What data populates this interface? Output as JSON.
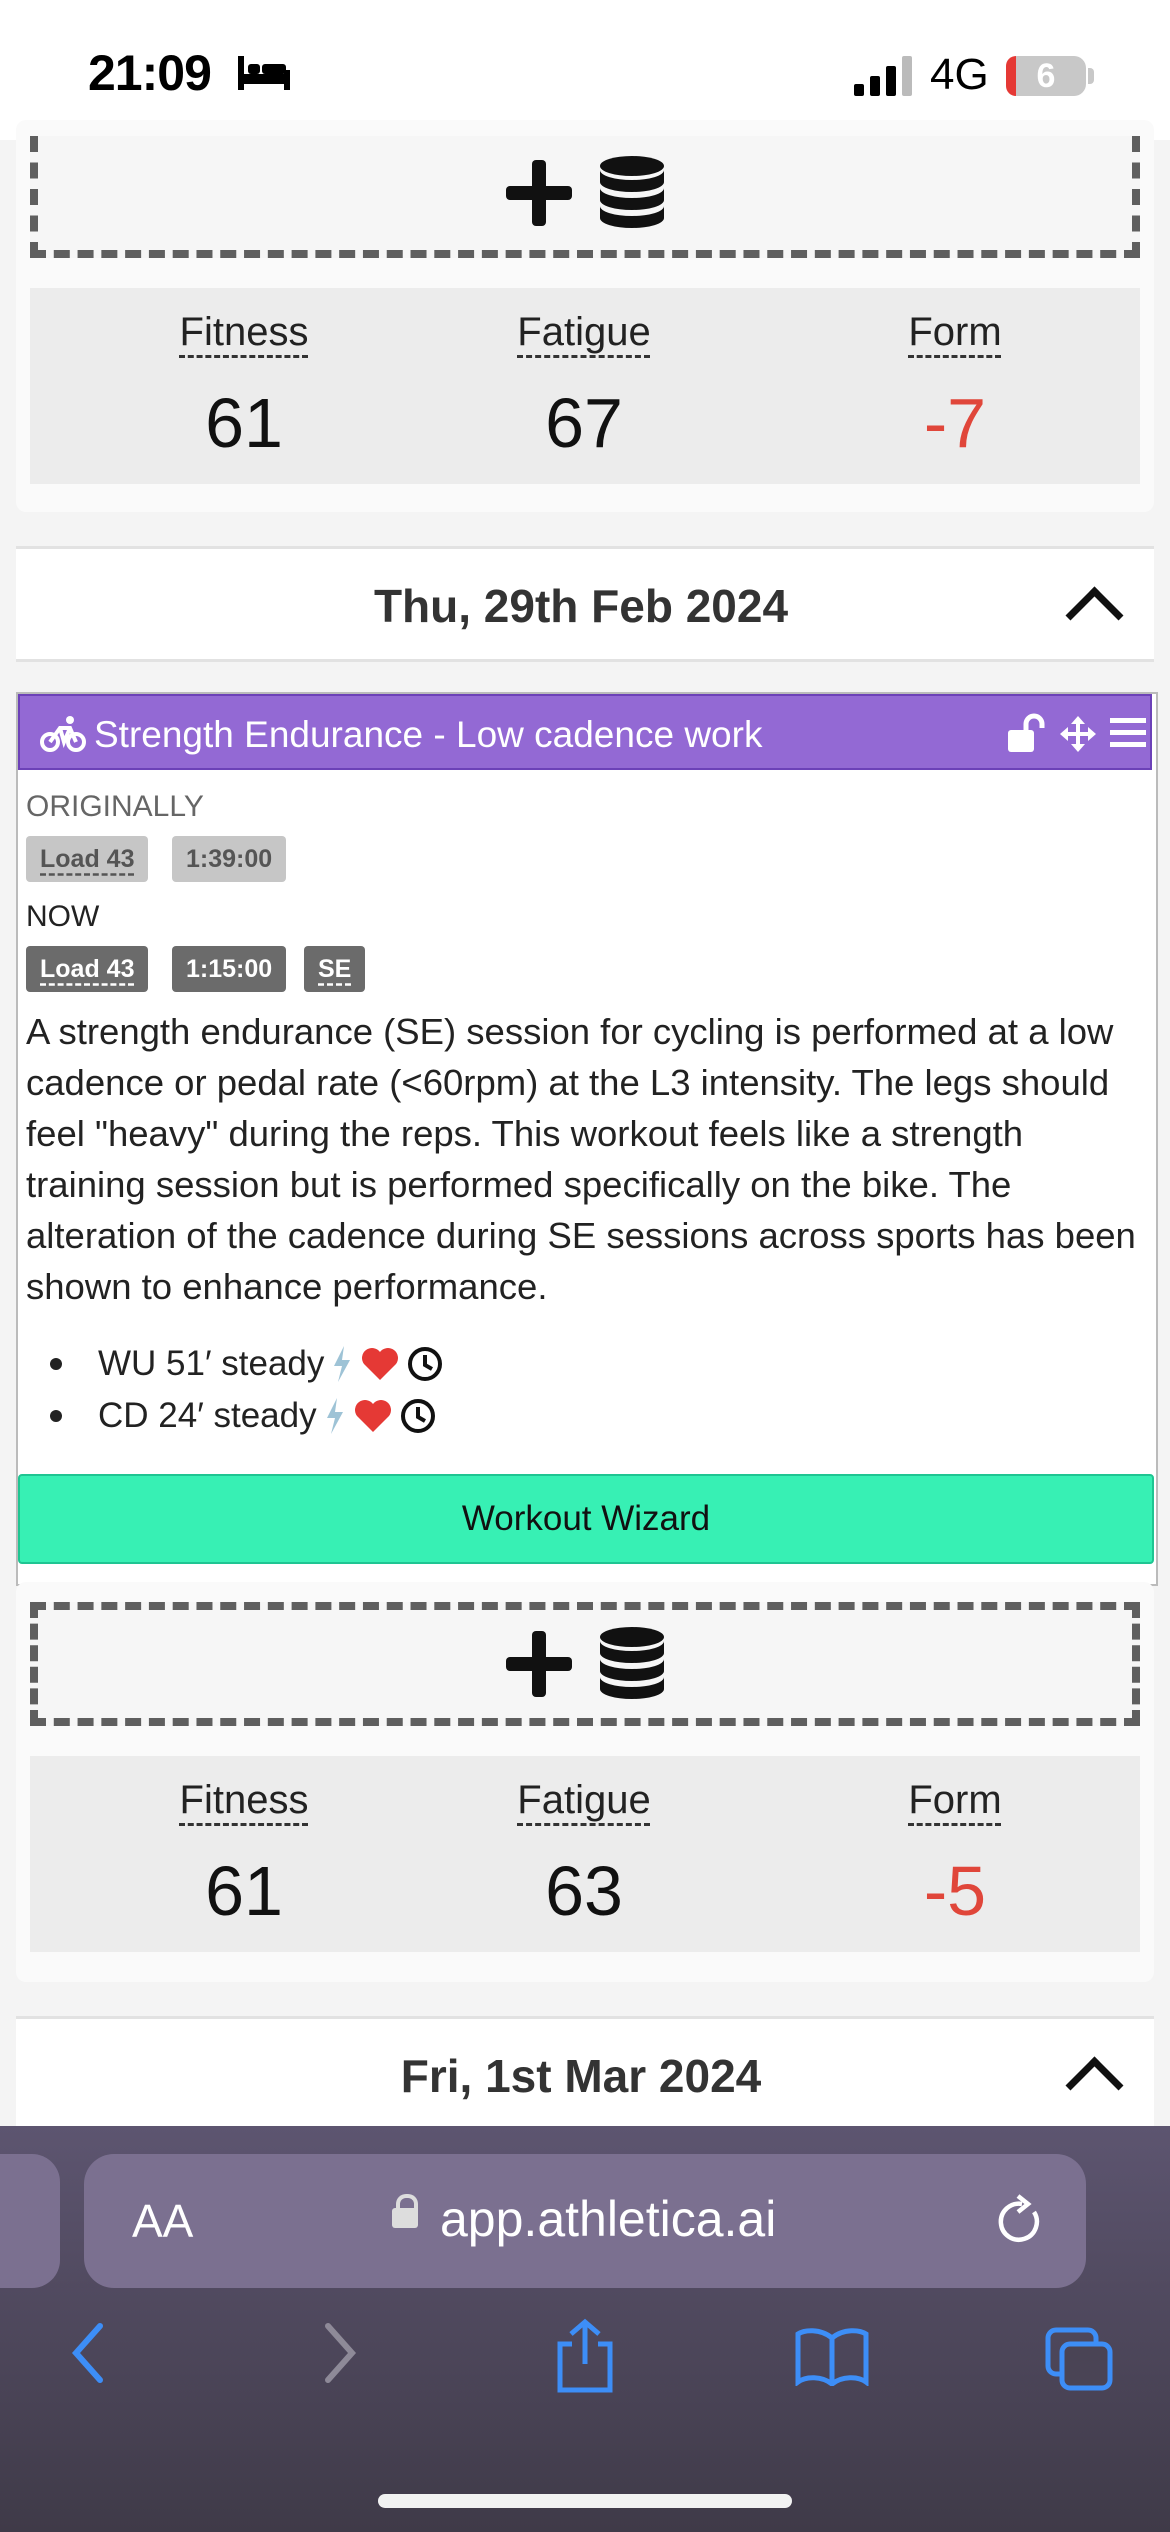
{
  "status": {
    "time": "21:09",
    "network": "4G",
    "battery": "6"
  },
  "blocks": [
    {
      "stats": {
        "fitness_label": "Fitness",
        "fitness": "61",
        "fatigue_label": "Fatigue",
        "fatigue": "67",
        "form_label": "Form",
        "form": "-7"
      }
    },
    {
      "stats": {
        "fitness_label": "Fitness",
        "fitness": "61",
        "fatigue_label": "Fatigue",
        "fatigue": "63",
        "form_label": "Form",
        "form": "-5"
      }
    }
  ],
  "days": [
    {
      "title": "Thu, 29th Feb 2024"
    },
    {
      "title": "Fri, 1st Mar 2024"
    }
  ],
  "workout": {
    "title": "Strength Endurance - Low cadence work",
    "originally_label": "ORIGINALLY",
    "orig_load": "Load 43",
    "orig_duration": "1:39:00",
    "now_label": "NOW",
    "now_load": "Load 43",
    "now_duration": "1:15:00",
    "now_type": "SE",
    "description": "A strength endurance (SE) session for cycling is performed at a low cadence or pedal rate (<60rpm) at the L3 intensity. The legs should feel \"heavy\" during the reps. This workout feels like a strength training session but is performed specifically on the bike. The alteration of the cadence during SE sessions across sports has been shown to enhance performance.",
    "steps": [
      "WU 51′ steady",
      "CD 24′ steady"
    ],
    "wizard_label": "Workout Wizard",
    "accent_color": "#9369d4"
  },
  "browser": {
    "text_size_label": "AA",
    "url": "app.athletica.ai"
  },
  "colors": {
    "negative": "#e0463a",
    "wizard": "#37f0b4"
  }
}
